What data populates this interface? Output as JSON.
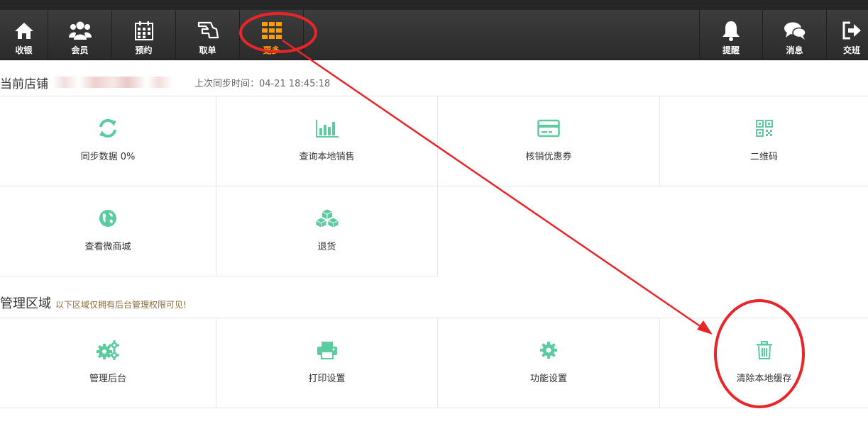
{
  "nav": {
    "items": [
      {
        "label": "收银",
        "icon": "home-icon"
      },
      {
        "label": "会员",
        "icon": "members-icon"
      },
      {
        "label": "预约",
        "icon": "calendar-icon"
      },
      {
        "label": "取单",
        "icon": "takeout-icon"
      },
      {
        "label": "更多",
        "icon": "grid-icon",
        "active": true
      }
    ],
    "right_items": [
      {
        "label": "提醒",
        "icon": "bell-icon"
      },
      {
        "label": "消息",
        "icon": "chat-icon"
      },
      {
        "label": "交班",
        "icon": "logout-icon"
      }
    ]
  },
  "store": {
    "label": "当前店铺",
    "sync_time": "上次同步时间：04-21 18:45:18"
  },
  "functions": [
    {
      "label": "同步数据 0%",
      "icon": "sync-icon"
    },
    {
      "label": "查询本地销售",
      "icon": "bar-chart-icon"
    },
    {
      "label": "核销优惠券",
      "icon": "credit-card-icon"
    },
    {
      "label": "二维码",
      "icon": "qrcode-icon"
    },
    {
      "label": "查看微商城",
      "icon": "globe-icon"
    },
    {
      "label": "退货",
      "icon": "boxes-icon"
    }
  ],
  "admin": {
    "title": "管理区域",
    "note": "以下区域仅拥有后台管理权限可见!",
    "items": [
      {
        "label": "管理后台",
        "icon": "gears-icon"
      },
      {
        "label": "打印设置",
        "icon": "printer-icon"
      },
      {
        "label": "功能设置",
        "icon": "gear-icon"
      },
      {
        "label": "清除本地缓存",
        "icon": "trash-icon"
      }
    ]
  },
  "colors": {
    "accent": "#5ccba0",
    "active_nav": "#ff9d00",
    "annotation": "#e8262a",
    "navbar": "#333333"
  }
}
